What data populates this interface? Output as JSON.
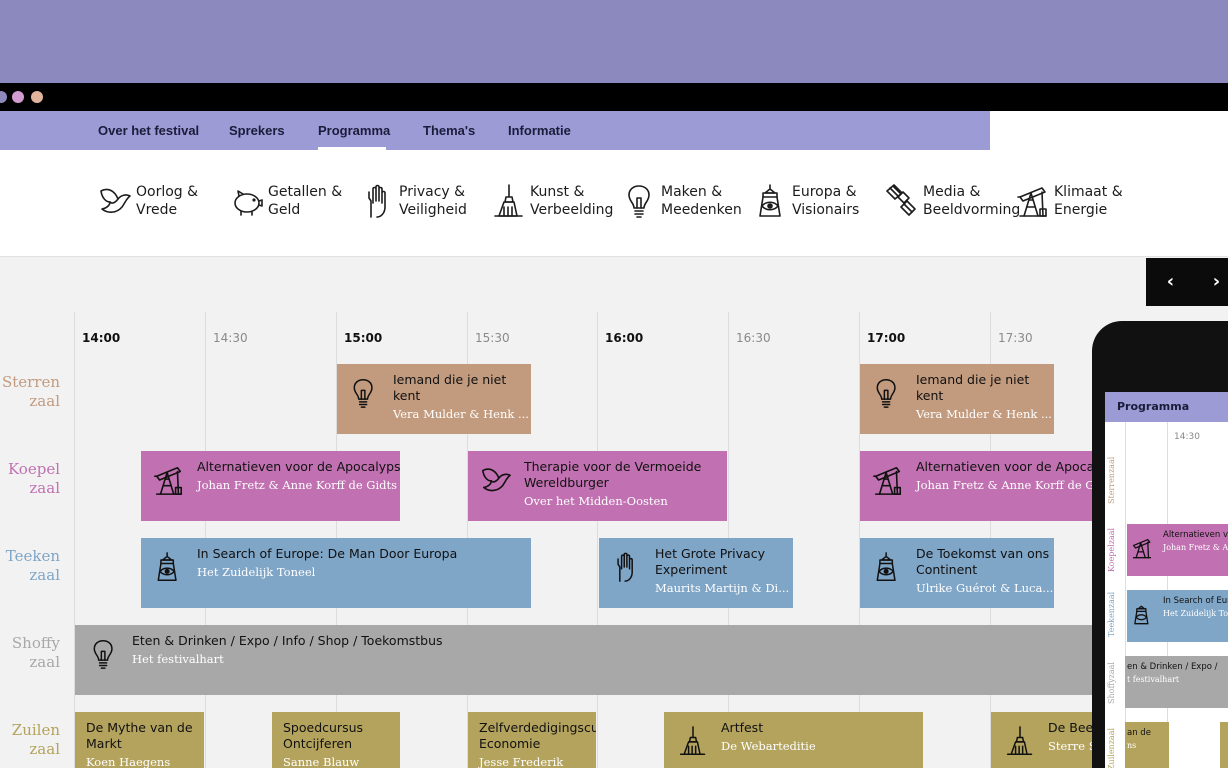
{
  "colors": {
    "top_band": "#8b89bd",
    "nav_bar": "#9d9bd6",
    "dot_1": "#8b89bd",
    "dot_2": "#d39cd0",
    "dot_3": "#e0b59b",
    "room_sterren": "#c29b7e",
    "room_koepel": "#c171b1",
    "room_teeken": "#7fa5c7",
    "room_shoffy": "#a8a8a8",
    "room_zuilen": "#b4a35d"
  },
  "nav": {
    "items": [
      {
        "label": "Over het festival"
      },
      {
        "label": "Sprekers"
      },
      {
        "label": "Programma",
        "active": true
      },
      {
        "label": "Thema's"
      },
      {
        "label": "Informatie"
      }
    ]
  },
  "themes": [
    {
      "line1": "Oorlog &",
      "line2": "Vrede",
      "icon": "dove-icon"
    },
    {
      "line1": "Getallen &",
      "line2": "Geld",
      "icon": "piggy-bank-icon"
    },
    {
      "line1": "Privacy &",
      "line2": "Veiligheid",
      "icon": "raised-hand-icon"
    },
    {
      "line1": "Kunst &",
      "line2": "Verbeelding",
      "icon": "paintbrush-icon"
    },
    {
      "line1": "Maken &",
      "line2": "Meedenken",
      "icon": "lightbulb-icon"
    },
    {
      "line1": "Europa &",
      "line2": "Visionairs",
      "icon": "lighthouse-eye-icon"
    },
    {
      "line1": "Media &",
      "line2": "Beeldvorming",
      "icon": "satellite-icon"
    },
    {
      "line1": "Klimaat &",
      "line2": "Energie",
      "icon": "oil-pump-icon"
    }
  ],
  "pager": {
    "prev": "‹",
    "next": "›"
  },
  "times": [
    "14:00",
    "14:30",
    "15:00",
    "15:30",
    "16:00",
    "16:30",
    "17:00",
    "17:30"
  ],
  "rooms": [
    {
      "line1": "Sterren",
      "line2": "zaal"
    },
    {
      "line1": "Koepel",
      "line2": "zaal"
    },
    {
      "line1": "Teeken",
      "line2": "zaal"
    },
    {
      "line1": "Shoffy",
      "line2": "zaal"
    },
    {
      "line1": "Zuilen",
      "line2": "zaal"
    }
  ],
  "events": [
    {
      "title": "Iemand die je niet",
      "title2": "kent",
      "sub": "Vera Mulder & Henk ...",
      "icon": "lightbulb-icon"
    },
    {
      "title": "Iemand die je niet",
      "title2": "kent",
      "sub": "Vera Mulder & Henk ...",
      "icon": "lightbulb-icon"
    },
    {
      "title": "Alternatieven voor de Apocalyps",
      "sub": "Johan Fretz & Anne Korff de Gidts",
      "icon": "oil-pump-icon"
    },
    {
      "title": "Therapie voor de Vermoeide",
      "title2": "Wereldburger",
      "sub": "Over het Midden-Oosten",
      "icon": "dove-icon"
    },
    {
      "title": "Alternatieven voor de Apocalyps",
      "sub": "Johan Fretz & Anne Korff de Gidts",
      "icon": "oil-pump-icon"
    },
    {
      "title": "In Search of Europe: De Man Door Europa",
      "sub": "Het Zuidelijk Toneel",
      "icon": "lighthouse-eye-icon"
    },
    {
      "title": "Het Grote Privacy",
      "title2": "Experiment",
      "sub": "Maurits Martijn & Di...",
      "icon": "raised-hand-icon"
    },
    {
      "title": "De Toekomst van ons",
      "title2": "Continent",
      "sub": "Ulrike Guérot & Luca...",
      "icon": "lighthouse-eye-icon"
    },
    {
      "title": "Eten & Drinken / Expo / Info / Shop / Toekomstbus",
      "sub": "Het festivalhart",
      "icon": "lightbulb-icon"
    },
    {
      "title": "De Mythe van de",
      "title2": "Markt",
      "sub": "Koen Haegens"
    },
    {
      "title": "Spoedcursus",
      "title2": "Ontcijferen",
      "sub": "Sanne Blauw"
    },
    {
      "title": "Zelfverdedigingscursus",
      "title2": "Economie",
      "sub": "Jesse Frederik"
    },
    {
      "title": "Artfest",
      "sub": "De Webarteditie",
      "icon": "paintbrush-icon"
    },
    {
      "title": "De Beeld",
      "sub": "Sterre Sp",
      "icon": "paintbrush-icon"
    }
  ],
  "phone": {
    "header": "Programma",
    "time": "14:30",
    "rooms": [
      "Sterrenzaal",
      "Koepelzaal",
      "Teekenzaal",
      "Shoffyzaal",
      "Zuilenzaal"
    ],
    "events": [
      {
        "title": "Alternatieven vo",
        "sub": "Johan Fretz & A"
      },
      {
        "title": "In Search of Eur",
        "sub": "Het Zuidelijk To"
      },
      {
        "title": "en & Drinken / Expo /",
        "sub": "t festivalhart"
      },
      {
        "title": "an de",
        "sub": "ns"
      }
    ]
  }
}
